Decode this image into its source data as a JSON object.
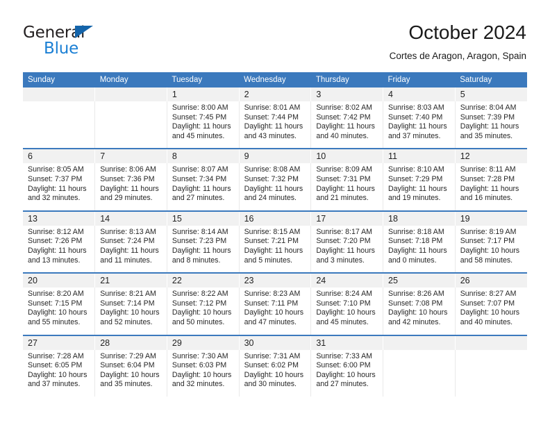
{
  "brand": {
    "name_part1": "General",
    "name_part2": "Blue",
    "triangle_icon": "logo-triangle-icon"
  },
  "header": {
    "month_title": "October 2024",
    "location": "Cortes de Aragon, Aragon, Spain"
  },
  "colors": {
    "header_blue": "#3b79bd",
    "date_band_gray": "#f1f1f1",
    "brand_blue": "#1a7fd4",
    "logo_triangle_blue": "#1464aa",
    "text": "#222222"
  },
  "calendar": {
    "weekday_headers": [
      "Sunday",
      "Monday",
      "Tuesday",
      "Wednesday",
      "Thursday",
      "Friday",
      "Saturday"
    ],
    "labels": {
      "sunrise": "Sunrise:",
      "sunset": "Sunset:",
      "daylight": "Daylight:"
    },
    "weeks": [
      [
        {
          "day": "",
          "lines": [
            "",
            "",
            "",
            ""
          ]
        },
        {
          "day": "",
          "lines": [
            "",
            "",
            "",
            ""
          ]
        },
        {
          "day": "1",
          "lines": [
            "Sunrise: 8:00 AM",
            "Sunset: 7:45 PM",
            "Daylight: 11 hours",
            "and 45 minutes."
          ]
        },
        {
          "day": "2",
          "lines": [
            "Sunrise: 8:01 AM",
            "Sunset: 7:44 PM",
            "Daylight: 11 hours",
            "and 43 minutes."
          ]
        },
        {
          "day": "3",
          "lines": [
            "Sunrise: 8:02 AM",
            "Sunset: 7:42 PM",
            "Daylight: 11 hours",
            "and 40 minutes."
          ]
        },
        {
          "day": "4",
          "lines": [
            "Sunrise: 8:03 AM",
            "Sunset: 7:40 PM",
            "Daylight: 11 hours",
            "and 37 minutes."
          ]
        },
        {
          "day": "5",
          "lines": [
            "Sunrise: 8:04 AM",
            "Sunset: 7:39 PM",
            "Daylight: 11 hours",
            "and 35 minutes."
          ]
        }
      ],
      [
        {
          "day": "6",
          "lines": [
            "Sunrise: 8:05 AM",
            "Sunset: 7:37 PM",
            "Daylight: 11 hours",
            "and 32 minutes."
          ]
        },
        {
          "day": "7",
          "lines": [
            "Sunrise: 8:06 AM",
            "Sunset: 7:36 PM",
            "Daylight: 11 hours",
            "and 29 minutes."
          ]
        },
        {
          "day": "8",
          "lines": [
            "Sunrise: 8:07 AM",
            "Sunset: 7:34 PM",
            "Daylight: 11 hours",
            "and 27 minutes."
          ]
        },
        {
          "day": "9",
          "lines": [
            "Sunrise: 8:08 AM",
            "Sunset: 7:32 PM",
            "Daylight: 11 hours",
            "and 24 minutes."
          ]
        },
        {
          "day": "10",
          "lines": [
            "Sunrise: 8:09 AM",
            "Sunset: 7:31 PM",
            "Daylight: 11 hours",
            "and 21 minutes."
          ]
        },
        {
          "day": "11",
          "lines": [
            "Sunrise: 8:10 AM",
            "Sunset: 7:29 PM",
            "Daylight: 11 hours",
            "and 19 minutes."
          ]
        },
        {
          "day": "12",
          "lines": [
            "Sunrise: 8:11 AM",
            "Sunset: 7:28 PM",
            "Daylight: 11 hours",
            "and 16 minutes."
          ]
        }
      ],
      [
        {
          "day": "13",
          "lines": [
            "Sunrise: 8:12 AM",
            "Sunset: 7:26 PM",
            "Daylight: 11 hours",
            "and 13 minutes."
          ]
        },
        {
          "day": "14",
          "lines": [
            "Sunrise: 8:13 AM",
            "Sunset: 7:24 PM",
            "Daylight: 11 hours",
            "and 11 minutes."
          ]
        },
        {
          "day": "15",
          "lines": [
            "Sunrise: 8:14 AM",
            "Sunset: 7:23 PM",
            "Daylight: 11 hours",
            "and 8 minutes."
          ]
        },
        {
          "day": "16",
          "lines": [
            "Sunrise: 8:15 AM",
            "Sunset: 7:21 PM",
            "Daylight: 11 hours",
            "and 5 minutes."
          ]
        },
        {
          "day": "17",
          "lines": [
            "Sunrise: 8:17 AM",
            "Sunset: 7:20 PM",
            "Daylight: 11 hours",
            "and 3 minutes."
          ]
        },
        {
          "day": "18",
          "lines": [
            "Sunrise: 8:18 AM",
            "Sunset: 7:18 PM",
            "Daylight: 11 hours",
            "and 0 minutes."
          ]
        },
        {
          "day": "19",
          "lines": [
            "Sunrise: 8:19 AM",
            "Sunset: 7:17 PM",
            "Daylight: 10 hours",
            "and 58 minutes."
          ]
        }
      ],
      [
        {
          "day": "20",
          "lines": [
            "Sunrise: 8:20 AM",
            "Sunset: 7:15 PM",
            "Daylight: 10 hours",
            "and 55 minutes."
          ]
        },
        {
          "day": "21",
          "lines": [
            "Sunrise: 8:21 AM",
            "Sunset: 7:14 PM",
            "Daylight: 10 hours",
            "and 52 minutes."
          ]
        },
        {
          "day": "22",
          "lines": [
            "Sunrise: 8:22 AM",
            "Sunset: 7:12 PM",
            "Daylight: 10 hours",
            "and 50 minutes."
          ]
        },
        {
          "day": "23",
          "lines": [
            "Sunrise: 8:23 AM",
            "Sunset: 7:11 PM",
            "Daylight: 10 hours",
            "and 47 minutes."
          ]
        },
        {
          "day": "24",
          "lines": [
            "Sunrise: 8:24 AM",
            "Sunset: 7:10 PM",
            "Daylight: 10 hours",
            "and 45 minutes."
          ]
        },
        {
          "day": "25",
          "lines": [
            "Sunrise: 8:26 AM",
            "Sunset: 7:08 PM",
            "Daylight: 10 hours",
            "and 42 minutes."
          ]
        },
        {
          "day": "26",
          "lines": [
            "Sunrise: 8:27 AM",
            "Sunset: 7:07 PM",
            "Daylight: 10 hours",
            "and 40 minutes."
          ]
        }
      ],
      [
        {
          "day": "27",
          "lines": [
            "Sunrise: 7:28 AM",
            "Sunset: 6:05 PM",
            "Daylight: 10 hours",
            "and 37 minutes."
          ]
        },
        {
          "day": "28",
          "lines": [
            "Sunrise: 7:29 AM",
            "Sunset: 6:04 PM",
            "Daylight: 10 hours",
            "and 35 minutes."
          ]
        },
        {
          "day": "29",
          "lines": [
            "Sunrise: 7:30 AM",
            "Sunset: 6:03 PM",
            "Daylight: 10 hours",
            "and 32 minutes."
          ]
        },
        {
          "day": "30",
          "lines": [
            "Sunrise: 7:31 AM",
            "Sunset: 6:02 PM",
            "Daylight: 10 hours",
            "and 30 minutes."
          ]
        },
        {
          "day": "31",
          "lines": [
            "Sunrise: 7:33 AM",
            "Sunset: 6:00 PM",
            "Daylight: 10 hours",
            "and 27 minutes."
          ]
        },
        {
          "day": "",
          "lines": [
            "",
            "",
            "",
            ""
          ]
        },
        {
          "day": "",
          "lines": [
            "",
            "",
            "",
            ""
          ]
        }
      ]
    ]
  }
}
